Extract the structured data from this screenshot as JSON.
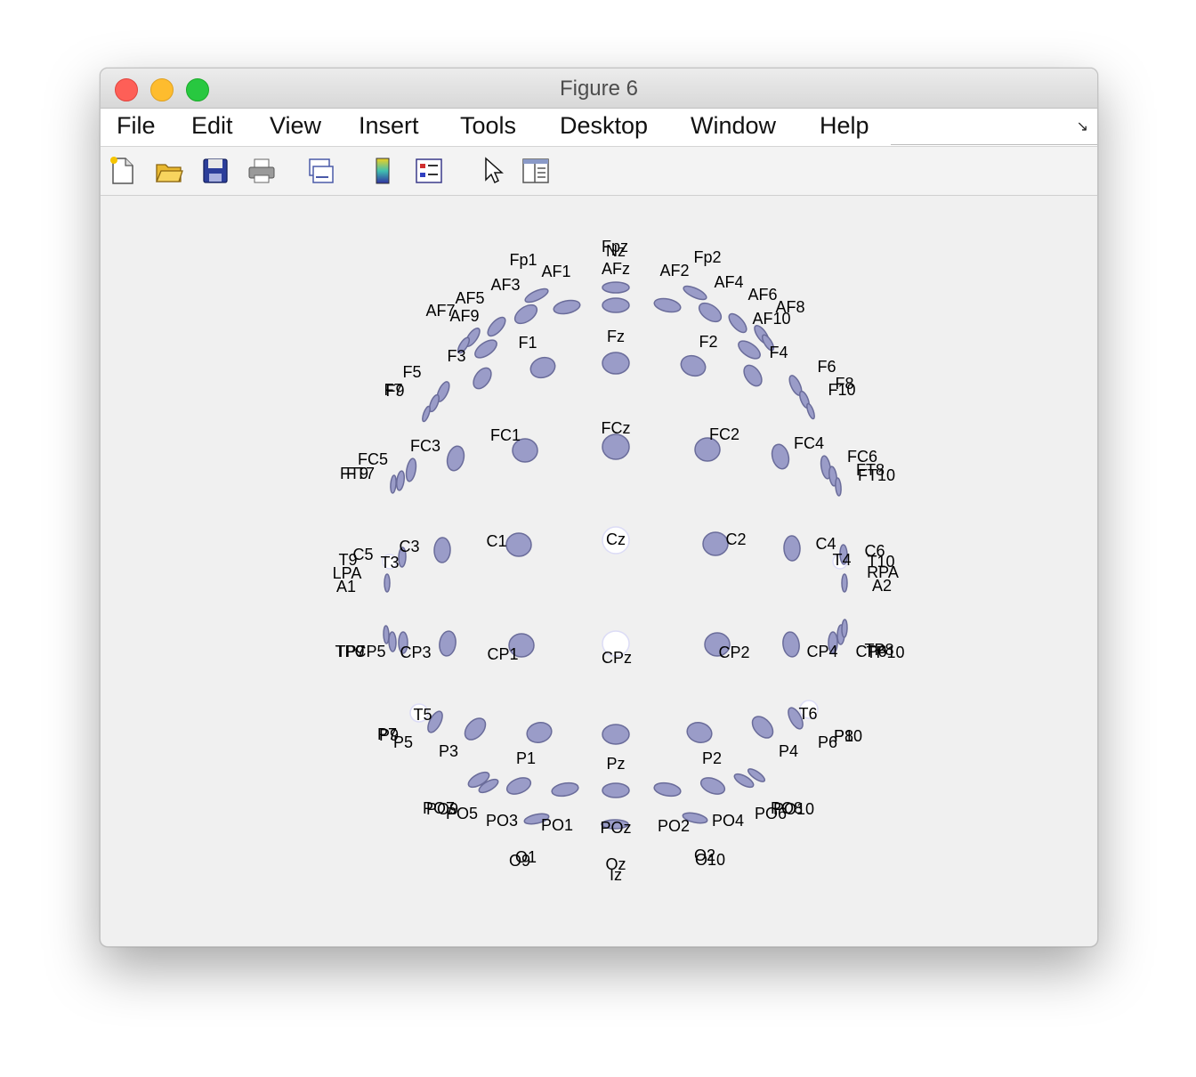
{
  "window": {
    "title": "Figure 6"
  },
  "menu": [
    "File",
    "Edit",
    "View",
    "Insert",
    "Tools",
    "Desktop",
    "Window",
    "Help"
  ],
  "toolbar": [
    {
      "icon": "new-figure-icon"
    },
    {
      "icon": "open-file-icon"
    },
    {
      "icon": "save-icon"
    },
    {
      "icon": "print-icon"
    },
    {
      "icon": "link-plot-icon"
    },
    {
      "icon": "colorbar-icon"
    },
    {
      "icon": "legend-icon"
    },
    {
      "icon": "pointer-icon"
    },
    {
      "icon": "property-inspector-icon"
    }
  ],
  "colors": {
    "electrode": "#9a9cc8",
    "electrode_edge": "#6a6c9a",
    "electrode_light": "#dcdcf6"
  },
  "electrodes": [
    "Fpz",
    "Nz",
    "AFz",
    "Fp1",
    "AF1",
    "AF2",
    "Fp2",
    "AF3",
    "AF4",
    "AF5",
    "AF6",
    "AF7",
    "AF9",
    "AF8",
    "AF10",
    "F1",
    "Fz",
    "F2",
    "F3",
    "F4",
    "F5",
    "F6",
    "F7",
    "F9",
    "F8",
    "F10",
    "FC1",
    "FCz",
    "FC2",
    "FC3",
    "FC4",
    "FC5",
    "FC6",
    "FT7",
    "FT9",
    "FT8",
    "FT10",
    "C1",
    "Cz",
    "C2",
    "C3",
    "C4",
    "C5",
    "C6",
    "T3",
    "T4",
    "T9",
    "T10",
    "LPA",
    "RPA",
    "A1",
    "A2",
    "TP7",
    "TP9",
    "CP5",
    "CP3",
    "CP1",
    "CPz",
    "CP2",
    "CP4",
    "CP6",
    "TP8",
    "TP10",
    "T5",
    "T6",
    "P7",
    "P9",
    "P5",
    "P3",
    "P1",
    "Pz",
    "P2",
    "P4",
    "P6",
    "P8",
    "P10",
    "PO7",
    "PO9",
    "PO5",
    "PO3",
    "PO1",
    "POz",
    "PO2",
    "PO4",
    "PO6",
    "PO8",
    "PO10",
    "O1",
    "O9",
    "Oz",
    "Iz",
    "O2",
    "O10"
  ]
}
